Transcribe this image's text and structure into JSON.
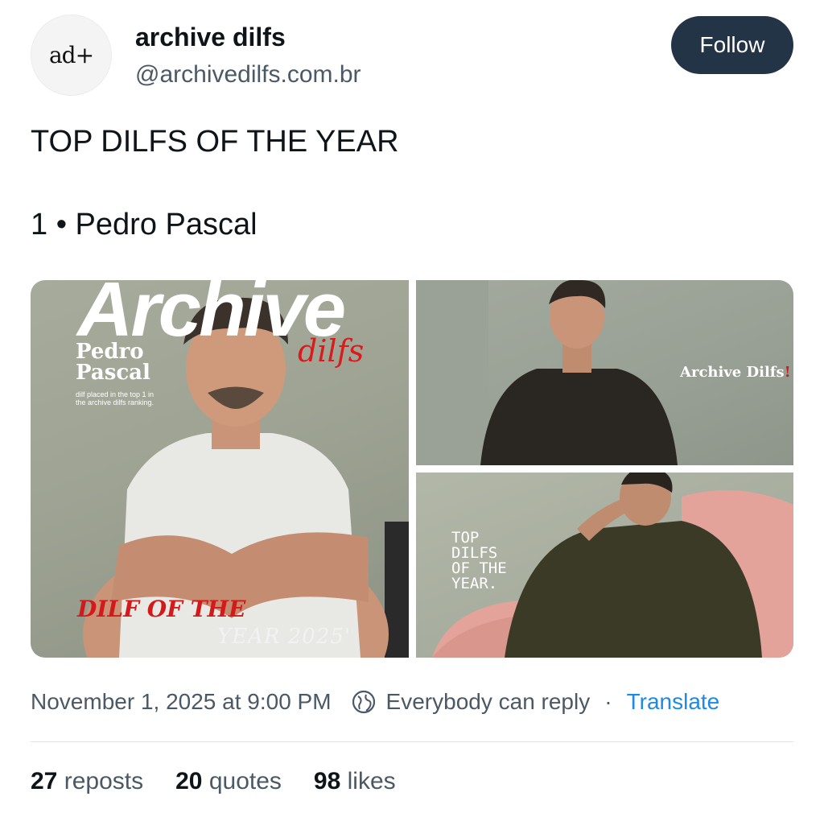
{
  "account": {
    "avatar_text": "ad+",
    "name": "archive dilfs",
    "handle": "@archivedilfs.com.br",
    "follow_label": "Follow"
  },
  "post": {
    "line1": "TOP DILFS OF THE YEAR",
    "line2": "1 • Pedro Pascal"
  },
  "media": {
    "image1": {
      "title": "Archive",
      "subtitle": "dilfs",
      "name_line1": "Pedro",
      "name_line2": "Pascal",
      "small_text": "dilf placed in the top 1 in the archive dilfs ranking.",
      "headline_red": "DILF OF THE",
      "headline_year": "YEAR 2025'"
    },
    "image2": {
      "brand": "Archive Dilfs",
      "brand_mark": "!"
    },
    "image3": {
      "line1": "TOP",
      "line2": "DILFS",
      "line3": "OF THE",
      "line4": "YEAR."
    }
  },
  "meta": {
    "timestamp": "November 1, 2025 at 9:00 PM",
    "reply_setting": "Everybody can reply",
    "separator": "·",
    "translate": "Translate",
    "icon": "globe-icon"
  },
  "stats": {
    "reposts_count": "27",
    "reposts_label": "reposts",
    "quotes_count": "20",
    "quotes_label": "quotes",
    "likes_count": "98",
    "likes_label": "likes"
  },
  "colors": {
    "follow_bg": "#243447",
    "link": "#1d8ae6",
    "muted": "#4b5966",
    "accent_red": "#d21a1a"
  }
}
